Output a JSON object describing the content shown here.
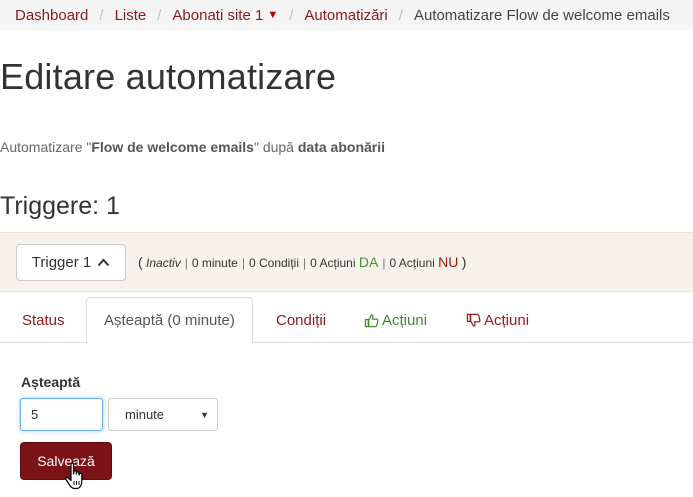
{
  "breadcrumb": {
    "items": [
      "Dashboard",
      "Liste",
      "Abonati site 1",
      "Automatizări"
    ],
    "current": "Automatizare Flow de welcome emails",
    "separator": "/"
  },
  "page": {
    "title": "Editare automatizare",
    "subtitle_prefix": "Automatizare \"",
    "subtitle_name": "Flow de welcome emails",
    "subtitle_mid": "\" după ",
    "subtitle_basis": "data abonării"
  },
  "triggers": {
    "title": "Triggere: 1",
    "trigger_button": "Trigger 1",
    "status": "Inactiv",
    "wait": "0 minute",
    "conditions": "0 Condiții",
    "actions_yes": "0 Acțiuni",
    "yes_label": "DA",
    "actions_no": "0 Acțiuni",
    "no_label": "NU"
  },
  "tabs": {
    "status": "Status",
    "wait": "Așteaptă (0 minute)",
    "conditions": "Condiții",
    "actions_yes": "Acțiuni",
    "actions_no": "Acțiuni"
  },
  "form": {
    "label": "Așteaptă",
    "value": "5",
    "unit": "minute",
    "save": "Salvează"
  },
  "colors": {
    "brand": "#7a1216",
    "link": "#8b1a1a",
    "yes": "#4a8f3a",
    "no": "#a01818"
  }
}
